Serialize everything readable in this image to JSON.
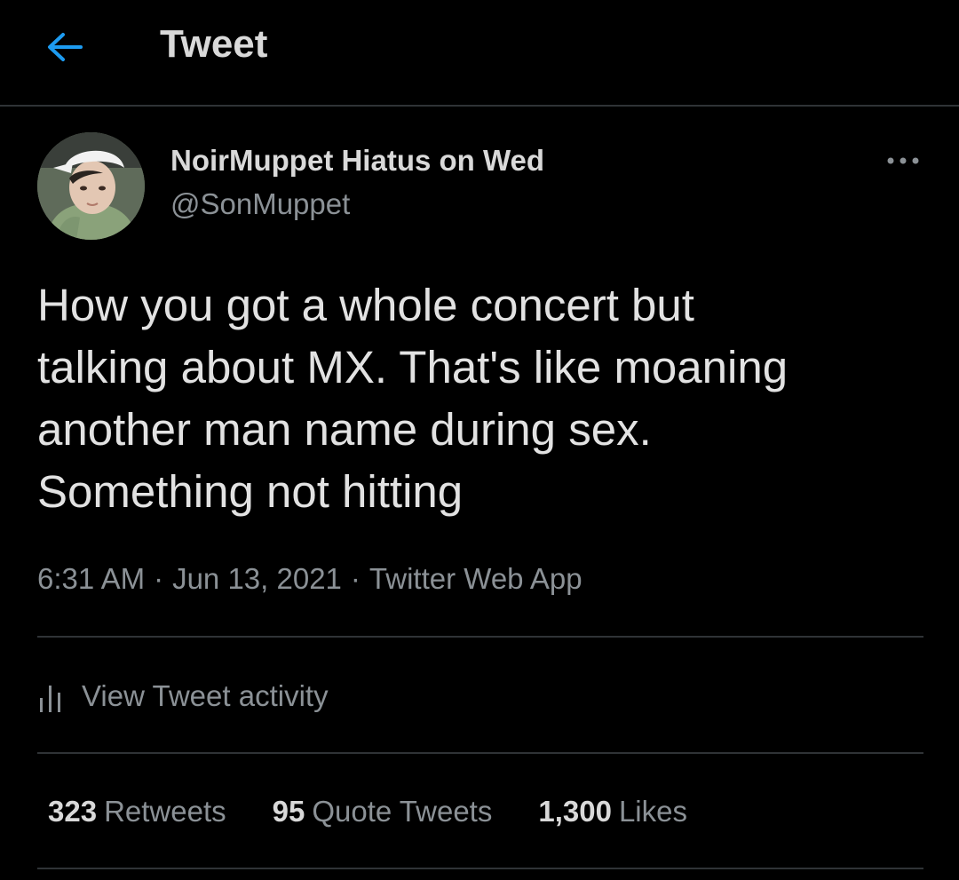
{
  "header": {
    "title": "Tweet",
    "back_icon": "arrow-left-icon",
    "accent_color": "#1d9bf0"
  },
  "author": {
    "display_name": "NoirMuppet Hiatus on Wed",
    "handle": "@SonMuppet",
    "avatar": "avatar-photo"
  },
  "more_icon": "more-horizontal-icon",
  "tweet": {
    "lines": [
      "How you got a whole concert but",
      "talking about MX. That's like moaning",
      "another man name during sex.",
      "Something not hitting"
    ],
    "time": "6:31 AM",
    "separator": "·",
    "date": "Jun 13, 2021",
    "source": "Twitter Web App"
  },
  "activity": {
    "label": "View Tweet activity",
    "icon": "bar-chart-icon"
  },
  "stats": {
    "retweets_count": "323",
    "retweets_label": "Retweets",
    "quotes_count": "95",
    "quotes_label": "Quote Tweets",
    "likes_count": "1,300",
    "likes_label": "Likes"
  }
}
